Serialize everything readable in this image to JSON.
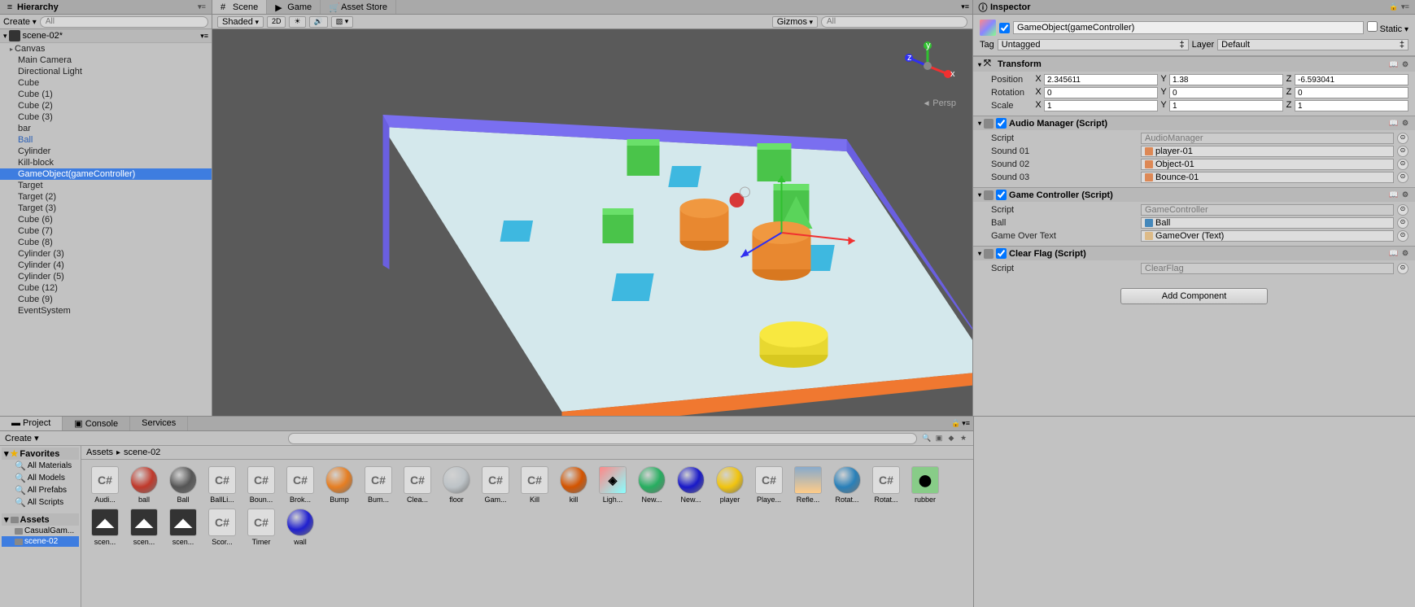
{
  "hierarchy": {
    "title": "Hierarchy",
    "create_label": "Create",
    "search_placeholder": "All",
    "scene_name": "scene-02*",
    "items": [
      {
        "label": "Canvas",
        "fold": true
      },
      {
        "label": "Main Camera"
      },
      {
        "label": "Directional Light"
      },
      {
        "label": "Cube"
      },
      {
        "label": "Cube (1)"
      },
      {
        "label": "Cube (2)"
      },
      {
        "label": "Cube (3)"
      },
      {
        "label": "bar"
      },
      {
        "label": "Ball",
        "blue": true
      },
      {
        "label": "Cylinder"
      },
      {
        "label": "Kill-block"
      },
      {
        "label": "GameObject(gameController)",
        "selected": true
      },
      {
        "label": "Target"
      },
      {
        "label": "Target (2)"
      },
      {
        "label": "Target (3)"
      },
      {
        "label": "Cube (6)"
      },
      {
        "label": "Cube (7)"
      },
      {
        "label": "Cube (8)"
      },
      {
        "label": "Cylinder (3)"
      },
      {
        "label": "Cylinder (4)"
      },
      {
        "label": "Cylinder (5)"
      },
      {
        "label": "Cube (12)"
      },
      {
        "label": "Cube (9)"
      },
      {
        "label": "EventSystem"
      }
    ]
  },
  "scene": {
    "tabs": [
      {
        "label": "Scene",
        "active": true,
        "icon": "scene"
      },
      {
        "label": "Game",
        "icon": "game"
      },
      {
        "label": "Asset Store",
        "icon": "store"
      }
    ],
    "toolbar": {
      "shading": "Shaded",
      "mode_2d": "2D",
      "gizmos": "Gizmos",
      "search_placeholder": "All"
    },
    "persp_label": "Persp"
  },
  "inspector": {
    "title": "Inspector",
    "name": "GameObject(gameController)",
    "static_label": "Static",
    "tag_label": "Tag",
    "tag_value": "Untagged",
    "layer_label": "Layer",
    "layer_value": "Default",
    "transform": {
      "title": "Transform",
      "position_label": "Position",
      "rotation_label": "Rotation",
      "scale_label": "Scale",
      "pos": {
        "x": "2.345611",
        "y": "1.38",
        "z": "-6.593041"
      },
      "rot": {
        "x": "0",
        "y": "0",
        "z": "0"
      },
      "scale": {
        "x": "1",
        "y": "1",
        "z": "1"
      }
    },
    "audio_manager": {
      "title": "Audio Manager (Script)",
      "script_label": "Script",
      "script_value": "AudioManager",
      "sound01_label": "Sound 01",
      "sound01_value": "player-01",
      "sound02_label": "Sound 02",
      "sound02_value": "Object-01",
      "sound03_label": "Sound 03",
      "sound03_value": "Bounce-01"
    },
    "game_controller": {
      "title": "Game Controller (Script)",
      "script_label": "Script",
      "script_value": "GameController",
      "ball_label": "Ball",
      "ball_value": "Ball",
      "gameover_label": "Game Over Text",
      "gameover_value": "GameOver (Text)"
    },
    "clear_flag": {
      "title": "Clear Flag (Script)",
      "script_label": "Script",
      "script_value": "ClearFlag"
    },
    "add_component": "Add Component"
  },
  "project": {
    "tabs": [
      {
        "label": "Project",
        "active": true
      },
      {
        "label": "Console"
      },
      {
        "label": "Services"
      }
    ],
    "create_label": "Create",
    "favorites_label": "Favorites",
    "favorites": [
      "All Materials",
      "All Models",
      "All Prefabs",
      "All Scripts"
    ],
    "assets_label": "Assets",
    "folders": [
      {
        "label": "CasualGam..."
      },
      {
        "label": "scene-02",
        "selected": true
      }
    ],
    "breadcrumb": [
      "Assets",
      "scene-02"
    ],
    "assets": [
      {
        "label": "Audi...",
        "type": "cs"
      },
      {
        "label": "ball",
        "type": "sphere",
        "color": "#c0392b"
      },
      {
        "label": "Ball",
        "type": "sphere",
        "color": "#555"
      },
      {
        "label": "BallLi...",
        "type": "cs"
      },
      {
        "label": "Boun...",
        "type": "cs"
      },
      {
        "label": "Brok...",
        "type": "cs"
      },
      {
        "label": "Bump",
        "type": "sphere",
        "color": "#e67e22"
      },
      {
        "label": "Bum...",
        "type": "cs"
      },
      {
        "label": "Clea...",
        "type": "cs"
      },
      {
        "label": "floor",
        "type": "sphere",
        "color": "#bdc3c7"
      },
      {
        "label": "Gam...",
        "type": "cs"
      },
      {
        "label": "Kill",
        "type": "cs"
      },
      {
        "label": "kill",
        "type": "sphere",
        "color": "#d35400"
      },
      {
        "label": "Ligh...",
        "type": "cube3d"
      },
      {
        "label": "New...",
        "type": "sphere",
        "color": "#27ae60"
      },
      {
        "label": "New...",
        "type": "sphere",
        "color": "#1818c8"
      },
      {
        "label": "player",
        "type": "sphere",
        "color": "#f1c40f"
      },
      {
        "label": "Playe...",
        "type": "cs"
      },
      {
        "label": "Refle...",
        "type": "sky"
      },
      {
        "label": "Rotat...",
        "type": "sphere",
        "color": "#2980b9"
      },
      {
        "label": "Rotat...",
        "type": "cs"
      },
      {
        "label": "rubber",
        "type": "phys"
      },
      {
        "label": "scen...",
        "type": "unity"
      },
      {
        "label": "scen...",
        "type": "unity"
      },
      {
        "label": "scen...",
        "type": "unity"
      },
      {
        "label": "Scor...",
        "type": "cs"
      },
      {
        "label": "Timer",
        "type": "cs"
      },
      {
        "label": "wall",
        "type": "sphere",
        "color": "#2020d0"
      }
    ]
  }
}
